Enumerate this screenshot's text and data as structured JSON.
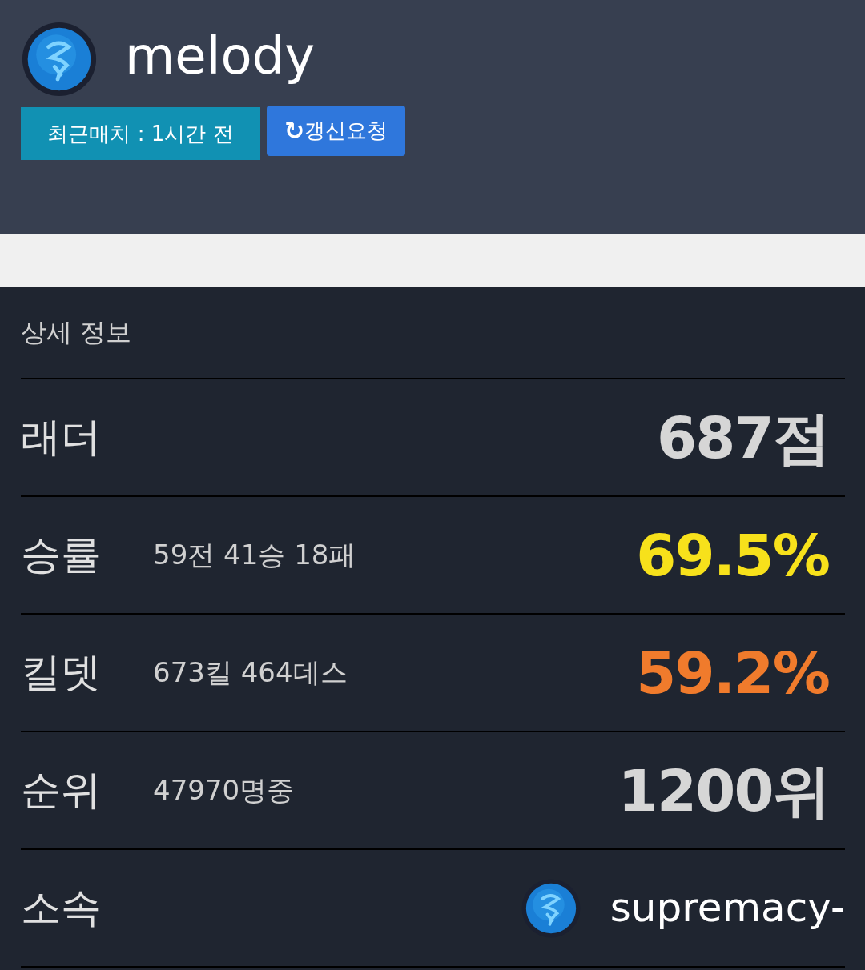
{
  "profile": {
    "name": "melody",
    "recent_match": "최근매치 : 1시간 전",
    "refresh_button": {
      "icon": "↻",
      "label": "갱신요청"
    }
  },
  "details": {
    "title": "상세 정보",
    "rows": [
      {
        "kind": "stat",
        "label": "래더",
        "value": "687점",
        "color": "#d6d6d6"
      },
      {
        "kind": "stat",
        "label": "승률",
        "detail": "59전 41승 18패",
        "value": "69.5%",
        "color": "#f7e11b"
      },
      {
        "kind": "stat",
        "label": "킬뎃",
        "detail": "673킬 464데스",
        "value": "59.2%",
        "color": "#f07b2c"
      },
      {
        "kind": "stat",
        "label": "순위",
        "detail": "47970명중",
        "value": "1200위",
        "color": "#d6d6d6"
      },
      {
        "kind": "clan",
        "label": "소속",
        "value": "supremacy-"
      }
    ]
  }
}
